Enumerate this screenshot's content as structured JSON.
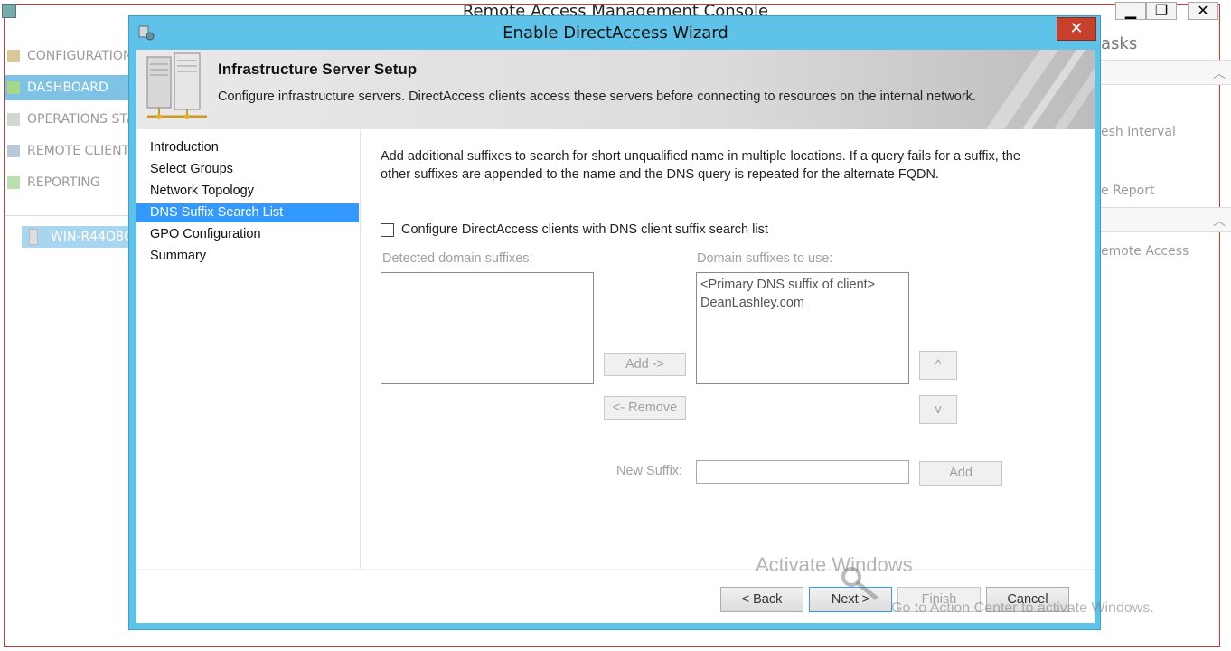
{
  "console": {
    "title": "Remote Access Management Console",
    "window_buttons": {
      "minimize": "▁",
      "maximize": "❐",
      "close": "✕"
    },
    "nav": [
      {
        "label": "CONFIGURATION",
        "icon": "configuration-icon"
      },
      {
        "label": "DASHBOARD",
        "icon": "dashboard-icon"
      },
      {
        "label": "OPERATIONS STA",
        "icon": "operations-status-icon"
      },
      {
        "label": "REMOTE CLIENT",
        "icon": "remote-client-icon"
      },
      {
        "label": "REPORTING",
        "icon": "reporting-icon"
      }
    ],
    "server": "WIN-R44O8C",
    "tasks": {
      "header": "asks",
      "refresh": "esh Interval",
      "report": "e Report",
      "remote_access": "emote Access"
    }
  },
  "wizard": {
    "title": "Enable DirectAccess Wizard",
    "close_label": "✕",
    "banner": {
      "heading": "Infrastructure Server Setup",
      "description": "Configure infrastructure servers. DirectAccess clients access these servers before connecting to resources on the internal network."
    },
    "steps": [
      {
        "label": "Introduction"
      },
      {
        "label": "Select Groups"
      },
      {
        "label": "Network Topology"
      },
      {
        "label": "DNS Suffix Search List"
      },
      {
        "label": "GPO Configuration"
      },
      {
        "label": "Summary"
      }
    ],
    "content": {
      "intro": "Add additional suffixes to search for short unqualified name in multiple locations. If a query fails for a suffix, the other suffixes are appended to the name and the DNS query is repeated for the alternate FQDN.",
      "checkbox_label": "Configure DirectAccess clients with DNS client suffix search list",
      "detected_label": "Detected domain suffixes:",
      "to_use_label": "Domain suffixes to use:",
      "detected_items": [],
      "to_use_items": [
        "<Primary DNS suffix of client>",
        "DeanLashley.com"
      ],
      "add_arrow_button": "Add ->",
      "remove_button": "<- Remove",
      "up_button": "^",
      "down_button": "v",
      "new_suffix_label": "New Suffix:",
      "new_suffix_value": "",
      "add_button": "Add"
    },
    "footer": {
      "back": "< Back",
      "next": "Next >",
      "finish": "Finish",
      "cancel": "Cancel"
    }
  },
  "watermark": {
    "title": "Activate Windows",
    "subtitle": "Go to Action Center to activate Windows."
  }
}
